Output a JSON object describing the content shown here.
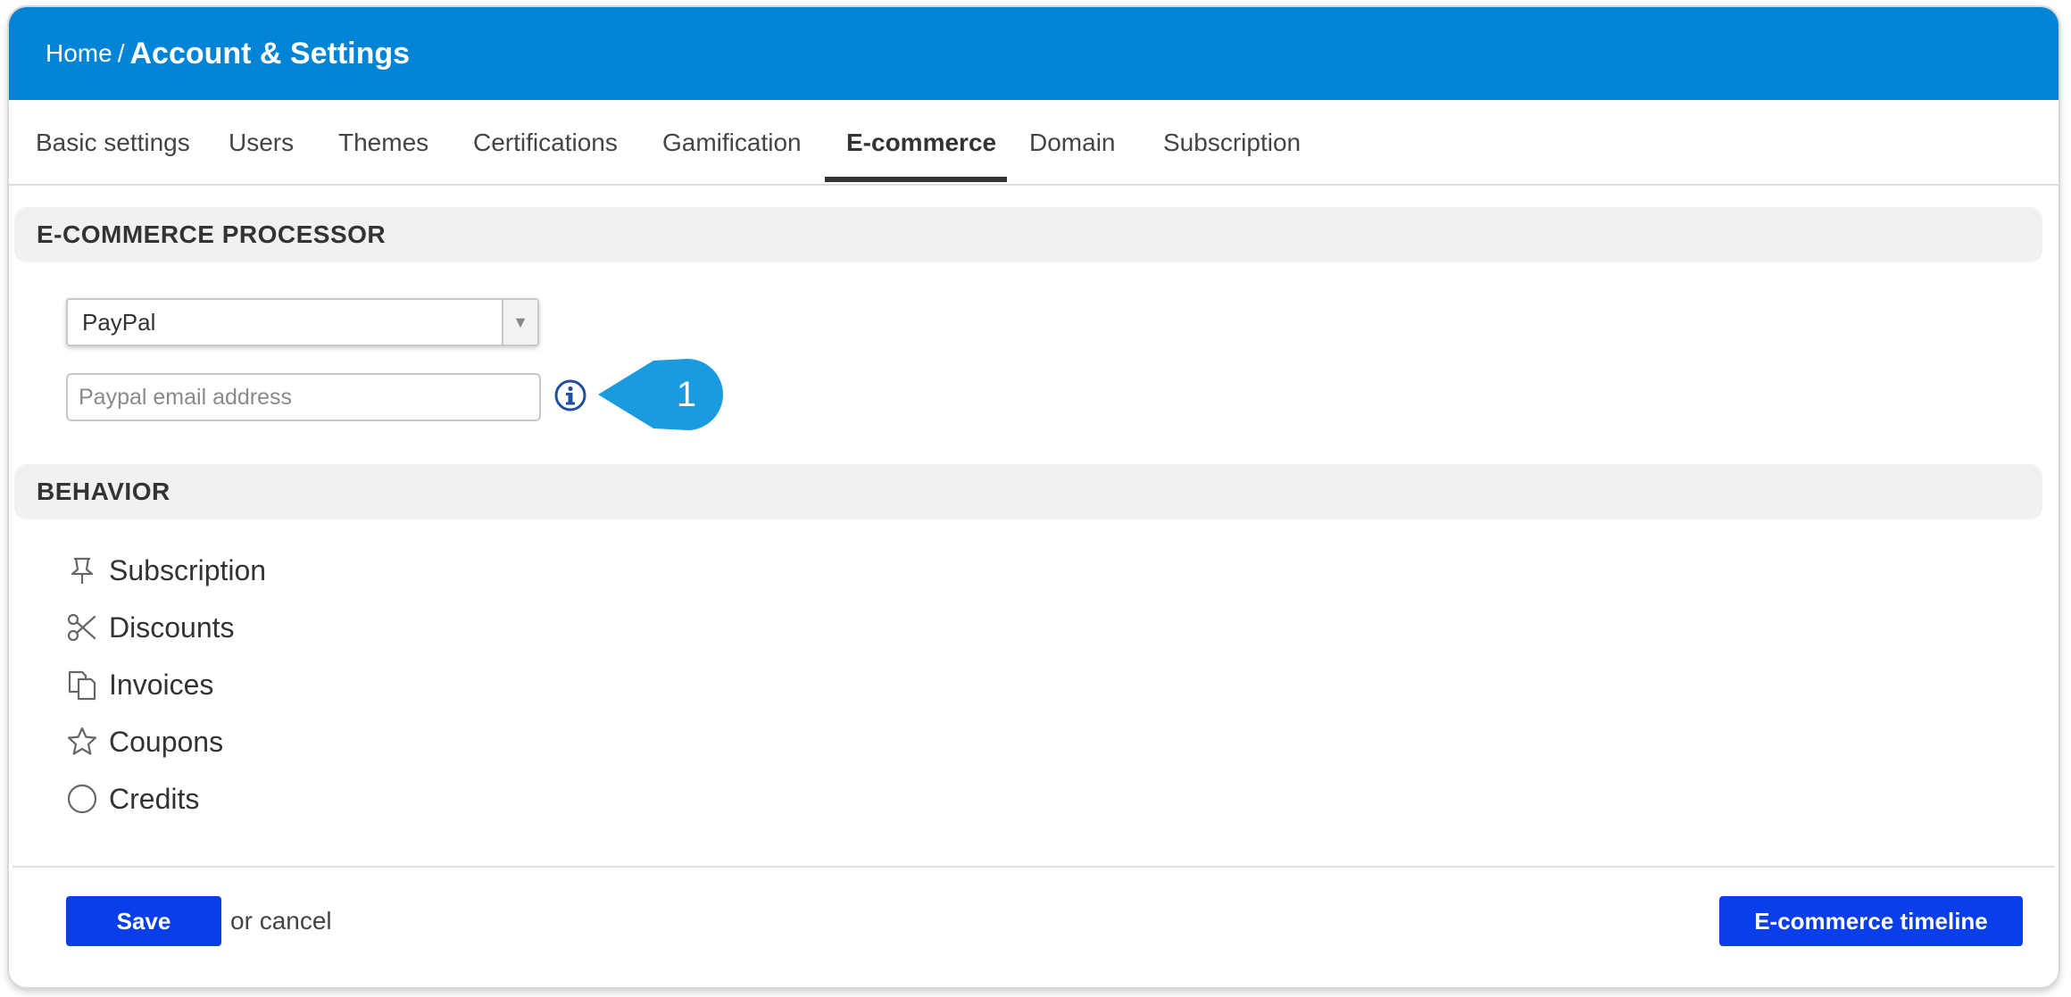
{
  "header": {
    "breadcrumb_home": "Home",
    "breadcrumb_sep": "/",
    "title": "Account & Settings",
    "bar_color": "#0284d6"
  },
  "tabs": [
    {
      "label": "Basic settings"
    },
    {
      "label": "Users"
    },
    {
      "label": "Themes"
    },
    {
      "label": "Certifications"
    },
    {
      "label": "Gamification"
    },
    {
      "label": "E-commerce",
      "active": true
    },
    {
      "label": "Domain"
    },
    {
      "label": "Subscription"
    }
  ],
  "processor": {
    "heading": "E-COMMERCE PROCESSOR",
    "selected": "PayPal",
    "email_placeholder": "Paypal email address",
    "email_value": "",
    "info_icon": "info-circle-icon",
    "callout_number": "1",
    "callout_color": "#1a9be0"
  },
  "behavior": {
    "heading": "BEHAVIOR",
    "items": [
      {
        "label": "Subscription",
        "icon": "pin-icon"
      },
      {
        "label": "Discounts",
        "icon": "scissors-icon"
      },
      {
        "label": "Invoices",
        "icon": "copy-documents-icon"
      },
      {
        "label": "Coupons",
        "icon": "star-icon"
      },
      {
        "label": "Credits",
        "icon": "circle-icon"
      }
    ]
  },
  "footer": {
    "save_label": "Save",
    "or_text": "or",
    "cancel_text": "cancel",
    "timeline_label": "E-commerce timeline",
    "button_color": "#0a3ee8"
  }
}
